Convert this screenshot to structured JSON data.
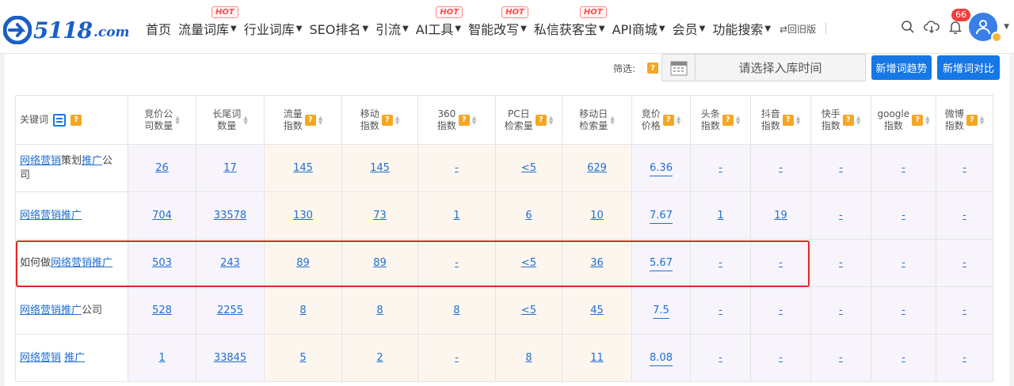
{
  "logo": {
    "word": "5118",
    "domain": ".com"
  },
  "nav": [
    {
      "label": "首页",
      "caret": false,
      "hot": false
    },
    {
      "label": "流量词库",
      "caret": true,
      "hot": true
    },
    {
      "label": "行业词库",
      "caret": true,
      "hot": false
    },
    {
      "label": "SEO排名",
      "caret": true,
      "hot": false
    },
    {
      "label": "引流",
      "caret": true,
      "hot": false
    },
    {
      "label": "AI工具",
      "caret": true,
      "hot": true
    },
    {
      "label": "智能改写",
      "caret": true,
      "hot": true
    },
    {
      "label": "私信获客宝",
      "caret": true,
      "hot": true
    },
    {
      "label": "API商城",
      "caret": true,
      "hot": false
    },
    {
      "label": "会员",
      "caret": true,
      "hot": false
    },
    {
      "label": "功能搜索",
      "caret": true,
      "hot": false
    }
  ],
  "hot_label": "HOT",
  "old_version": "⇄回旧版",
  "notification_count": "66",
  "filter": {
    "label": "筛选:",
    "date_placeholder": "请选择入库时间",
    "btn_trend": "新增词趋势",
    "btn_compare": "新增词对比"
  },
  "columns": [
    {
      "key": "kw",
      "label": "关键词",
      "lines": [
        "关键词"
      ]
    },
    {
      "key": "bid_count",
      "lines": [
        "竞价公",
        "司数量"
      ],
      "q": false
    },
    {
      "key": "long_tail",
      "lines": [
        "长尾词",
        "数量"
      ],
      "q": false
    },
    {
      "key": "traffic",
      "lines": [
        "流量",
        "指数"
      ],
      "q": true
    },
    {
      "key": "mobile",
      "lines": [
        "移动",
        "指数"
      ],
      "q": true
    },
    {
      "key": "s360",
      "lines": [
        "360",
        "指数"
      ],
      "q": true
    },
    {
      "key": "pc_daily",
      "lines": [
        "PC日",
        "检索量"
      ],
      "q": true
    },
    {
      "key": "mobile_daily",
      "lines": [
        "移动日",
        "检索量"
      ],
      "q": false
    },
    {
      "key": "bid_price",
      "lines": [
        "竞价",
        "价格"
      ],
      "q": true
    },
    {
      "key": "toutiao",
      "lines": [
        "头条",
        "指数"
      ],
      "q": true
    },
    {
      "key": "douyin",
      "lines": [
        "抖音",
        "指数"
      ],
      "q": true
    },
    {
      "key": "kuaishou",
      "lines": [
        "快手",
        "指数"
      ],
      "q": true
    },
    {
      "key": "google",
      "lines": [
        "google",
        "指数"
      ],
      "q": true
    },
    {
      "key": "weibo",
      "lines": [
        "微博",
        "指数"
      ],
      "q": true
    }
  ],
  "rows": [
    {
      "kw": [
        [
          "网络营销",
          "hl"
        ],
        [
          "策划",
          "pl"
        ],
        [
          "推广",
          "hl"
        ],
        [
          "公",
          "pl"
        ]
      ],
      "kw2": "司",
      "vals": [
        "26",
        "17",
        "145",
        "145",
        "-",
        "<5",
        "629",
        "6.36",
        "-",
        "-",
        "-",
        "-",
        "-"
      ]
    },
    {
      "kw": [
        [
          "网络营销推广",
          "hl"
        ]
      ],
      "kw2": "",
      "vals": [
        "704",
        "33578",
        "130",
        "73",
        "1",
        "6",
        "10",
        "7.67",
        "1",
        "19",
        "-",
        "-",
        "-"
      ]
    },
    {
      "kw": [
        [
          "如何做",
          "pl"
        ],
        [
          "网络营销推广",
          "hl"
        ]
      ],
      "kw2": "",
      "vals": [
        "503",
        "243",
        "89",
        "89",
        "-",
        "<5",
        "36",
        "5.67",
        "-",
        "-",
        "-",
        "-",
        "-"
      ]
    },
    {
      "kw": [
        [
          "网络营销推广",
          "hl"
        ],
        [
          "公司",
          "pl"
        ]
      ],
      "kw2": "",
      "vals": [
        "528",
        "2255",
        "8",
        "8",
        "8",
        "<5",
        "45",
        "7.5",
        "-",
        "-",
        "-",
        "-",
        "-"
      ]
    },
    {
      "kw": [
        [
          "网络营销",
          "hl"
        ],
        [
          " ",
          "pl"
        ],
        [
          "推广",
          "hl"
        ]
      ],
      "kw2": "",
      "vals": [
        "1",
        "33845",
        "5",
        "2",
        "-",
        "8",
        "11",
        "8.08",
        "-",
        "-",
        "-",
        "-",
        "-"
      ]
    }
  ],
  "colors": {
    "accent": "#1677e6",
    "hot": "#ff4b4b",
    "highlight_border": "#e32626",
    "q_badge": "#f5a623"
  }
}
